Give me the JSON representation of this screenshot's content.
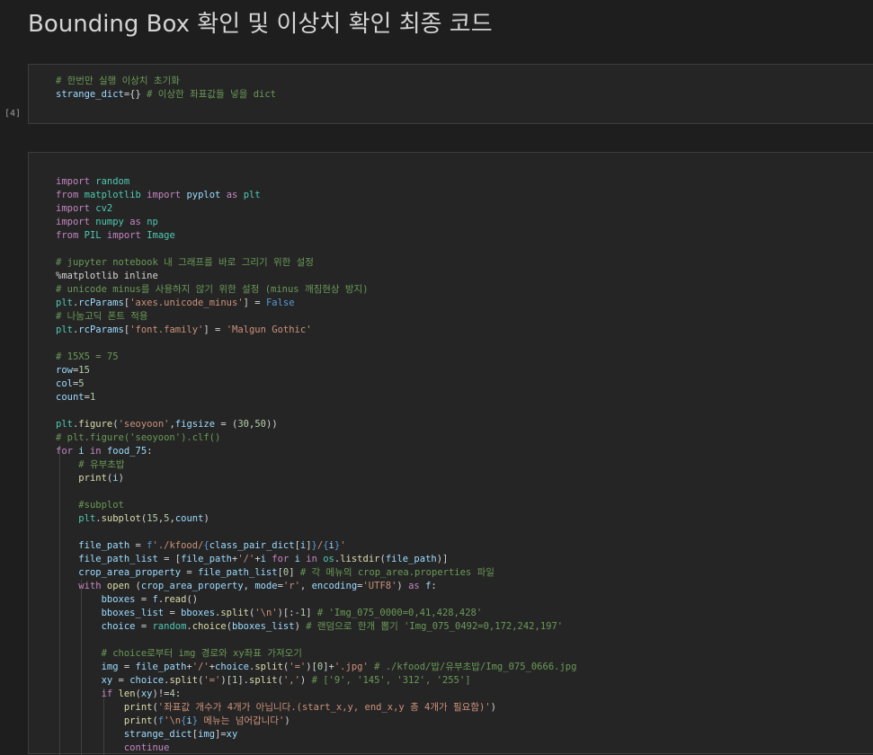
{
  "page_title": "Bounding Box 확인 및 이상치 확인 최종 코드",
  "cells": [
    {
      "execution_count": "[4]",
      "lines": [
        [
          [
            "cm",
            "# 한번만 실행 이상치 초기화"
          ]
        ],
        [
          [
            "var",
            "strange_dict"
          ],
          [
            "",
            "={} "
          ],
          [
            "cm",
            "# 이상한 좌표값들 넣을 dict"
          ]
        ]
      ]
    },
    {
      "execution_count": "",
      "lines": [
        [],
        [
          [
            "kw",
            "import"
          ],
          [
            "",
            " "
          ],
          [
            "cls",
            "random"
          ]
        ],
        [
          [
            "kw",
            "from"
          ],
          [
            "",
            " "
          ],
          [
            "cls",
            "matplotlib"
          ],
          [
            "",
            " "
          ],
          [
            "kw",
            "import"
          ],
          [
            "",
            " "
          ],
          [
            "var",
            "pyplot"
          ],
          [
            "",
            " "
          ],
          [
            "kw",
            "as"
          ],
          [
            "",
            " "
          ],
          [
            "cls",
            "plt"
          ]
        ],
        [
          [
            "kw",
            "import"
          ],
          [
            "",
            " "
          ],
          [
            "cls",
            "cv2"
          ]
        ],
        [
          [
            "kw",
            "import"
          ],
          [
            "",
            " "
          ],
          [
            "cls",
            "numpy"
          ],
          [
            "",
            " "
          ],
          [
            "kw",
            "as"
          ],
          [
            "",
            " "
          ],
          [
            "cls",
            "np"
          ]
        ],
        [
          [
            "kw",
            "from"
          ],
          [
            "",
            " "
          ],
          [
            "cls",
            "PIL"
          ],
          [
            "",
            " "
          ],
          [
            "kw",
            "import"
          ],
          [
            "",
            " "
          ],
          [
            "cls",
            "Image"
          ]
        ],
        [],
        [
          [
            "cm",
            "# jupyter notebook 내 그래프를 바로 그리기 위한 설정"
          ]
        ],
        [
          [
            "",
            "%matplotlib inline"
          ]
        ],
        [
          [
            "cm",
            "# unicode minus를 사용하지 않기 위한 설정 (minus 깨짐현상 방지)"
          ]
        ],
        [
          [
            "cls",
            "plt"
          ],
          [
            "",
            "."
          ],
          [
            "var",
            "rcParams"
          ],
          [
            "",
            "["
          ],
          [
            "str",
            "'axes.unicode_minus'"
          ],
          [
            "",
            "] = "
          ],
          [
            "kw2",
            "False"
          ]
        ],
        [
          [
            "cm",
            "# 나눔고딕 폰트 적용"
          ]
        ],
        [
          [
            "cls",
            "plt"
          ],
          [
            "",
            "."
          ],
          [
            "var",
            "rcParams"
          ],
          [
            "",
            "["
          ],
          [
            "str",
            "'font.family'"
          ],
          [
            "",
            "] = "
          ],
          [
            "str",
            "'Malgun Gothic'"
          ]
        ],
        [],
        [
          [
            "cm",
            "# 15X5 = 75"
          ]
        ],
        [
          [
            "var",
            "row"
          ],
          [
            "",
            "="
          ],
          [
            "num",
            "15"
          ]
        ],
        [
          [
            "var",
            "col"
          ],
          [
            "",
            "="
          ],
          [
            "num",
            "5"
          ]
        ],
        [
          [
            "var",
            "count"
          ],
          [
            "",
            "="
          ],
          [
            "num",
            "1"
          ]
        ],
        [],
        [
          [
            "cls",
            "plt"
          ],
          [
            "",
            "."
          ],
          [
            "fn",
            "figure"
          ],
          [
            "",
            "("
          ],
          [
            "str",
            "'seoyoon'"
          ],
          [
            "",
            ","
          ],
          [
            "var",
            "figsize"
          ],
          [
            "",
            " = ("
          ],
          [
            "num",
            "30"
          ],
          [
            "",
            ","
          ],
          [
            "num",
            "50"
          ],
          [
            "",
            "))"
          ]
        ],
        [
          [
            "cm",
            "# plt.figure('seoyoon').clf()"
          ]
        ],
        [
          [
            "kw",
            "for"
          ],
          [
            "",
            " "
          ],
          [
            "var",
            "i"
          ],
          [
            "",
            " "
          ],
          [
            "kw",
            "in"
          ],
          [
            "",
            " "
          ],
          [
            "var",
            "food_75"
          ],
          [
            "",
            ":"
          ]
        ],
        [
          [
            "",
            "    "
          ],
          [
            "cm",
            "# 유부초밥"
          ]
        ],
        [
          [
            "",
            "    "
          ],
          [
            "fn",
            "print"
          ],
          [
            "",
            "("
          ],
          [
            "var",
            "i"
          ],
          [
            "",
            ")"
          ]
        ],
        [],
        [
          [
            "",
            "    "
          ],
          [
            "cm",
            "#subplot"
          ]
        ],
        [
          [
            "",
            "    "
          ],
          [
            "cls",
            "plt"
          ],
          [
            "",
            "."
          ],
          [
            "fn",
            "subplot"
          ],
          [
            "",
            "("
          ],
          [
            "num",
            "15"
          ],
          [
            "",
            ","
          ],
          [
            "num",
            "5"
          ],
          [
            "",
            ","
          ],
          [
            "var",
            "count"
          ],
          [
            "",
            ")"
          ]
        ],
        [],
        [
          [
            "",
            "    "
          ],
          [
            "var",
            "file_path"
          ],
          [
            "",
            " = "
          ],
          [
            "kw2",
            "f"
          ],
          [
            "str",
            "'./kfood/"
          ],
          [
            "kw2",
            "{"
          ],
          [
            "var",
            "class_pair_dict"
          ],
          [
            "",
            "["
          ],
          [
            "var",
            "i"
          ],
          [
            "",
            "]"
          ],
          [
            "kw2",
            "}"
          ],
          [
            "str",
            "/"
          ],
          [
            "kw2",
            "{"
          ],
          [
            "var",
            "i"
          ],
          [
            "kw2",
            "}"
          ],
          [
            "str",
            "'"
          ]
        ],
        [
          [
            "",
            "    "
          ],
          [
            "var",
            "file_path_list"
          ],
          [
            "",
            " = ["
          ],
          [
            "var",
            "file_path"
          ],
          [
            "",
            "+"
          ],
          [
            "str",
            "'/'"
          ],
          [
            "",
            "+"
          ],
          [
            "var",
            "i"
          ],
          [
            "",
            " "
          ],
          [
            "kw",
            "for"
          ],
          [
            "",
            " "
          ],
          [
            "var",
            "i"
          ],
          [
            "",
            " "
          ],
          [
            "kw",
            "in"
          ],
          [
            "",
            " "
          ],
          [
            "cls",
            "os"
          ],
          [
            "",
            "."
          ],
          [
            "fn",
            "listdir"
          ],
          [
            "",
            "("
          ],
          [
            "var",
            "file_path"
          ],
          [
            "",
            ")]"
          ]
        ],
        [
          [
            "",
            "    "
          ],
          [
            "var",
            "crop_area_property"
          ],
          [
            "",
            " = "
          ],
          [
            "var",
            "file_path_list"
          ],
          [
            "",
            "["
          ],
          [
            "num",
            "0"
          ],
          [
            "",
            "] "
          ],
          [
            "cm",
            "# 각 메뉴의 crop_area.properties 파일"
          ]
        ],
        [
          [
            "",
            "    "
          ],
          [
            "kw",
            "with"
          ],
          [
            "",
            " "
          ],
          [
            "fn",
            "open"
          ],
          [
            "",
            " ("
          ],
          [
            "var",
            "crop_area_property"
          ],
          [
            "",
            ", "
          ],
          [
            "var",
            "mode"
          ],
          [
            "",
            "="
          ],
          [
            "str",
            "'r'"
          ],
          [
            "",
            ", "
          ],
          [
            "var",
            "encoding"
          ],
          [
            "",
            "="
          ],
          [
            "str",
            "'UTF8'"
          ],
          [
            "",
            ") "
          ],
          [
            "kw",
            "as"
          ],
          [
            "",
            " "
          ],
          [
            "var",
            "f"
          ],
          [
            "",
            ":"
          ]
        ],
        [
          [
            "",
            "        "
          ],
          [
            "var",
            "bboxes"
          ],
          [
            "",
            " = "
          ],
          [
            "var",
            "f"
          ],
          [
            "",
            "."
          ],
          [
            "fn",
            "read"
          ],
          [
            "",
            "()"
          ]
        ],
        [
          [
            "",
            "        "
          ],
          [
            "var",
            "bboxes_list"
          ],
          [
            "",
            " = "
          ],
          [
            "var",
            "bboxes"
          ],
          [
            "",
            "."
          ],
          [
            "fn",
            "split"
          ],
          [
            "",
            "("
          ],
          [
            "str",
            "'\\n'"
          ],
          [
            "",
            ")[:-"
          ],
          [
            "num",
            "1"
          ],
          [
            "",
            "] "
          ],
          [
            "cm",
            "# 'Img_075_0000=0,41,428,428'"
          ]
        ],
        [
          [
            "",
            "        "
          ],
          [
            "var",
            "choice"
          ],
          [
            "",
            " = "
          ],
          [
            "cls",
            "random"
          ],
          [
            "",
            "."
          ],
          [
            "fn",
            "choice"
          ],
          [
            "",
            "("
          ],
          [
            "var",
            "bboxes_list"
          ],
          [
            "",
            ") "
          ],
          [
            "cm",
            "# 랜덤으로 한개 뽑기 'Img_075_0492=0,172,242,197'"
          ]
        ],
        [],
        [
          [
            "",
            "        "
          ],
          [
            "cm",
            "# choice로부터 img 경로와 xy좌표 가져오기"
          ]
        ],
        [
          [
            "",
            "        "
          ],
          [
            "var",
            "img"
          ],
          [
            "",
            " = "
          ],
          [
            "var",
            "file_path"
          ],
          [
            "",
            "+"
          ],
          [
            "str",
            "'/'"
          ],
          [
            "",
            "+"
          ],
          [
            "var",
            "choice"
          ],
          [
            "",
            "."
          ],
          [
            "fn",
            "split"
          ],
          [
            "",
            "("
          ],
          [
            "str",
            "'='"
          ],
          [
            "",
            ")["
          ],
          [
            "num",
            "0"
          ],
          [
            "",
            "]+"
          ],
          [
            "str",
            "'.jpg'"
          ],
          [
            "",
            " "
          ],
          [
            "cm",
            "# ./kfood/밥/유부초밥/Img_075_0666.jpg"
          ]
        ],
        [
          [
            "",
            "        "
          ],
          [
            "var",
            "xy"
          ],
          [
            "",
            " = "
          ],
          [
            "var",
            "choice"
          ],
          [
            "",
            "."
          ],
          [
            "fn",
            "split"
          ],
          [
            "",
            "("
          ],
          [
            "str",
            "'='"
          ],
          [
            "",
            ")["
          ],
          [
            "num",
            "1"
          ],
          [
            "",
            "]."
          ],
          [
            "fn",
            "split"
          ],
          [
            "",
            "("
          ],
          [
            "str",
            "','"
          ],
          [
            "",
            ") "
          ],
          [
            "cm",
            "# ['9', '145', '312', '255']"
          ]
        ],
        [
          [
            "",
            "        "
          ],
          [
            "kw",
            "if"
          ],
          [
            "",
            " "
          ],
          [
            "fn",
            "len"
          ],
          [
            "",
            "("
          ],
          [
            "var",
            "xy"
          ],
          [
            "",
            ")!="
          ],
          [
            "num",
            "4"
          ],
          [
            "",
            ":"
          ]
        ],
        [
          [
            "",
            "            "
          ],
          [
            "fn",
            "print"
          ],
          [
            "",
            "("
          ],
          [
            "str",
            "'좌표값 개수가 4개가 아닙니다.(start_x,y, end_x,y 총 4개가 필요함)'"
          ],
          [
            "",
            ")"
          ]
        ],
        [
          [
            "",
            "            "
          ],
          [
            "fn",
            "print"
          ],
          [
            "",
            "("
          ],
          [
            "kw2",
            "f"
          ],
          [
            "str",
            "'\\n"
          ],
          [
            "kw2",
            "{"
          ],
          [
            "var",
            "i"
          ],
          [
            "kw2",
            "}"
          ],
          [
            "str",
            " 메뉴는 넘어갑니다'"
          ],
          [
            "",
            ")"
          ]
        ],
        [
          [
            "",
            "            "
          ],
          [
            "var",
            "strange_dict"
          ],
          [
            "",
            "["
          ],
          [
            "var",
            "img"
          ],
          [
            "",
            "]="
          ],
          [
            "var",
            "xy"
          ]
        ],
        [
          [
            "",
            "            "
          ],
          [
            "kw",
            "continue"
          ]
        ]
      ]
    }
  ]
}
